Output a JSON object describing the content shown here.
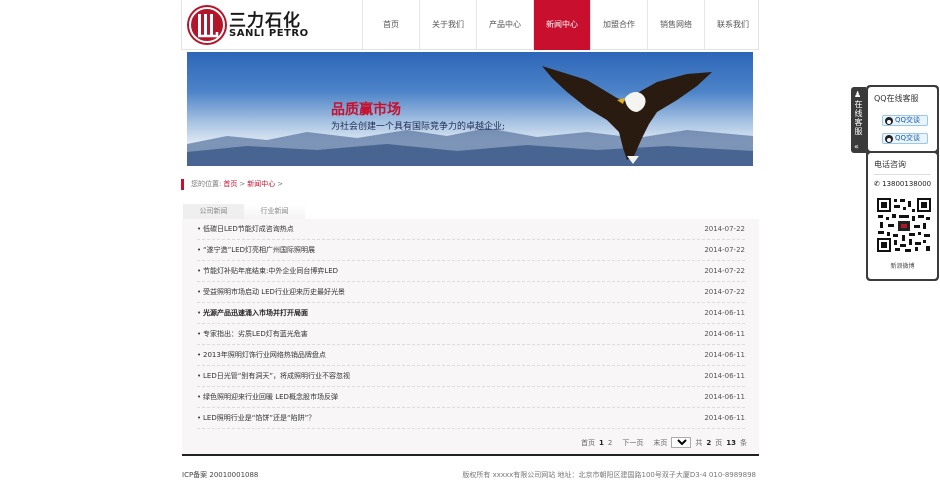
{
  "header": {
    "logo_cn": "三力石化",
    "logo_en": "SANLI PETRO",
    "nav": [
      {
        "label": "首页"
      },
      {
        "label": "关于我们"
      },
      {
        "label": "产品中心"
      },
      {
        "label": "新闻中心"
      },
      {
        "label": "加盟合作"
      },
      {
        "label": "销售网络"
      },
      {
        "label": "联系我们"
      }
    ],
    "active_nav_index": 3
  },
  "banner": {
    "title": "品质赢市场",
    "subtitle": "为社会创建一个具有国际竞争力的卓越企业;"
  },
  "breadcrumb": {
    "prefix": "您的位置:",
    "home": "首页",
    "sep1": ">",
    "current": "新闻中心",
    "sep2": ">"
  },
  "tabs": [
    {
      "label": "公司新闻"
    },
    {
      "label": "行业新闻"
    }
  ],
  "news": [
    {
      "title": "低碳日LED节能灯成咨询热点",
      "date": "2014-07-22",
      "bold": false
    },
    {
      "title": "“遂宁造”LED灯亮相广州国际照明展",
      "date": "2014-07-22",
      "bold": false
    },
    {
      "title": "节能灯补贴年底结束:中外企业同台博弈LED",
      "date": "2014-07-22",
      "bold": false
    },
    {
      "title": "受益照明市场启动 LED行业迎来历史最好光景",
      "date": "2014-07-22",
      "bold": false
    },
    {
      "title": "光源产品迅速涌入市场并打开局面",
      "date": "2014-06-11",
      "bold": true
    },
    {
      "title": "专家指出：劣质LED灯有蓝光危害",
      "date": "2014-06-11",
      "bold": false
    },
    {
      "title": "2013年照明灯饰行业网络热销品牌盘点",
      "date": "2014-06-11",
      "bold": false
    },
    {
      "title": "LED日光管“别有洞天”，将成照明行业不容忽视",
      "date": "2014-06-11",
      "bold": false
    },
    {
      "title": "绿色照明迎来行业回暖 LED概念股市场反弹",
      "date": "2014-06-11",
      "bold": false
    },
    {
      "title": "LED照明行业是“馅饼”还是“陷阱”？",
      "date": "2014-06-11",
      "bold": false
    }
  ],
  "pager": {
    "first": "首页",
    "current_page": "1",
    "page2": "2",
    "next": "下一页",
    "last": "末页",
    "selected": "1",
    "total_prefix": "共",
    "pages": "2",
    "total_mid": "页",
    "count": "13",
    "total_suffix": "条"
  },
  "footer": {
    "icp": "ICP备案 20010001088",
    "copyright": "版权所有 xxxxx有限公司网站  地址：北京市朝阳区建国路100号双子大厦D3-4 010-8989898"
  },
  "service": {
    "tab_text": "在线客服",
    "qq_title": "QQ在线客服",
    "qq_btn1": "QQ交谈",
    "qq_btn2": "QQ交谈",
    "phone_title": "电话咨询",
    "phone": "13800138000",
    "qr_caption": "新浪微博"
  },
  "colors": {
    "accent": "#c8102e",
    "panel": "#3b3b3b"
  }
}
